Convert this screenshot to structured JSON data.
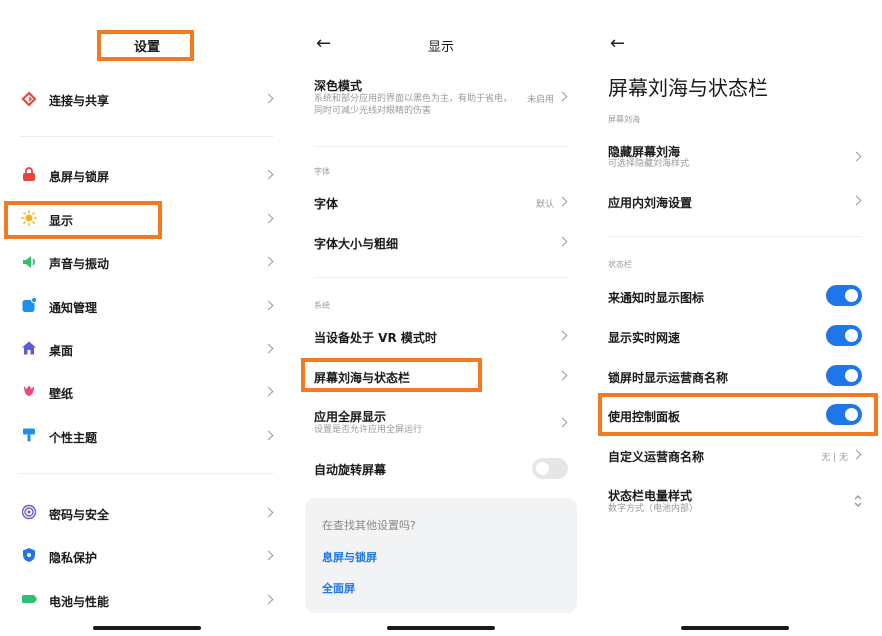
{
  "panel1": {
    "title": "设置",
    "items": [
      {
        "label": "连接与共享",
        "icon": "share-icon"
      },
      {
        "label": "息屏与锁屏",
        "icon": "lock-icon"
      },
      {
        "label": "显示",
        "icon": "sun-icon"
      },
      {
        "label": "声音与振动",
        "icon": "speaker-icon"
      },
      {
        "label": "通知管理",
        "icon": "notification-icon"
      },
      {
        "label": "桌面",
        "icon": "home-icon"
      },
      {
        "label": "壁纸",
        "icon": "tulip-icon"
      },
      {
        "label": "个性主题",
        "icon": "brush-icon"
      },
      {
        "label": "密码与安全",
        "icon": "fingerprint-icon"
      },
      {
        "label": "隐私保护",
        "icon": "shield-icon"
      },
      {
        "label": "电池与性能",
        "icon": "battery-icon"
      }
    ]
  },
  "panel2": {
    "title": "显示",
    "dark_mode": {
      "label": "深色模式",
      "sub": "系统和部分应用的界面以黑色为主，有助于省电，同时可减少光线对眼睛的伤害",
      "sub_line1": "系统和部分应用的界面以黑色为主，有助于省电，",
      "sub_line2": "同时可减少光线对眼睛的伤害",
      "value": "未启用"
    },
    "section_font": "字体",
    "font": {
      "label": "字体",
      "value": "默认"
    },
    "font_size": {
      "label": "字体大小与粗细"
    },
    "section_system": "系统",
    "vr": {
      "label": "当设备处于 VR 模式时"
    },
    "notch": {
      "label": "屏幕刘海与状态栏"
    },
    "fullscreen": {
      "label": "应用全屏显示",
      "sub": "设置是否允许应用全屏运行"
    },
    "auto_rotate": {
      "label": "自动旋转屏幕",
      "enabled": false
    },
    "search_card": {
      "question": "在查找其他设置吗?",
      "links": [
        "息屏与锁屏",
        "全面屏"
      ]
    }
  },
  "panel3": {
    "title": "屏幕刘海与状态栏",
    "section_notch": "屏幕刘海",
    "hide_notch": {
      "label": "隐藏屏幕刘海",
      "sub": "可选择隐藏刘海样式"
    },
    "app_notch": {
      "label": "应用内刘海设置"
    },
    "section_status": "状态栏",
    "toggles": [
      {
        "label": "来通知时显示图标",
        "enabled": true
      },
      {
        "label": "显示实时网速",
        "enabled": true
      },
      {
        "label": "锁屏时显示运营商名称",
        "enabled": true
      },
      {
        "label": "使用控制面板",
        "enabled": true
      }
    ],
    "carrier_name": {
      "label": "自定义运营商名称",
      "value": "无 | 无"
    },
    "battery_style": {
      "label": "状态栏电量样式",
      "sub": "数字方式（电池内部）"
    }
  },
  "colors": {
    "accent": "#1f76e8",
    "highlight": "#f47a20"
  }
}
